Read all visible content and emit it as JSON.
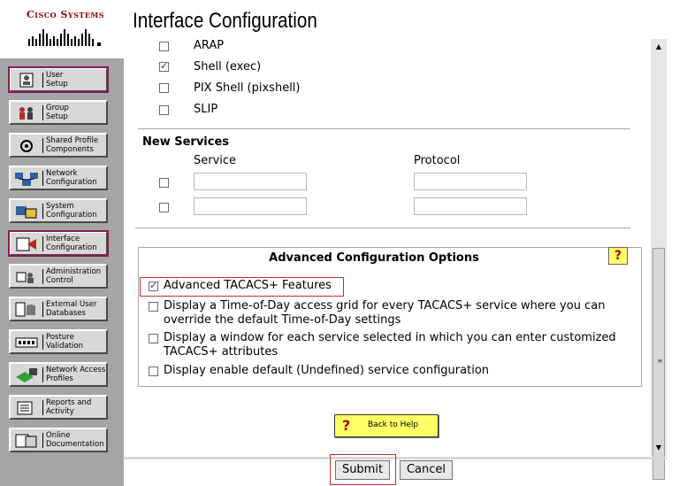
{
  "app": {
    "brand": "Cisco Systems",
    "page_title": "Interface Configuration"
  },
  "nav": [
    {
      "label": "User\nSetup",
      "icon": "user-setup-icon"
    },
    {
      "label": "Group\nSetup",
      "icon": "group-setup-icon"
    },
    {
      "label": "Shared Profile\nComponents",
      "icon": "shared-profile-icon"
    },
    {
      "label": "Network\nConfiguration",
      "icon": "network-config-icon"
    },
    {
      "label": "System\nConfiguration",
      "icon": "system-config-icon"
    },
    {
      "label": "Interface\nConfiguration",
      "icon": "interface-config-icon"
    },
    {
      "label": "Administration\nControl",
      "icon": "admin-control-icon"
    },
    {
      "label": "External User\nDatabases",
      "icon": "external-db-icon"
    },
    {
      "label": "Posture\nValidation",
      "icon": "posture-icon"
    },
    {
      "label": "Network Access\nProfiles",
      "icon": "nap-icon"
    },
    {
      "label": "Reports and\nActivity",
      "icon": "reports-icon"
    },
    {
      "label": "Online\nDocumentation",
      "icon": "docs-icon"
    }
  ],
  "services": [
    {
      "label": "ARAP",
      "checked": false
    },
    {
      "label": "Shell (exec)",
      "checked": true
    },
    {
      "label": "PIX Shell (pixshell)",
      "checked": false
    },
    {
      "label": "SLIP",
      "checked": false
    }
  ],
  "new_services": {
    "heading": "New Services",
    "service_col": "Service",
    "protocol_col": "Protocol",
    "rows": [
      {
        "checked": false,
        "service": "",
        "protocol": ""
      },
      {
        "checked": false,
        "service": "",
        "protocol": ""
      }
    ]
  },
  "advanced": {
    "title": "Advanced Configuration Options",
    "help_glyph": "?",
    "options": [
      {
        "label": "Advanced TACACS+ Features",
        "checked": true
      },
      {
        "label": "Display a Time-of-Day access grid for every TACACS+ service where you can override the default Time-of-Day settings",
        "checked": false
      },
      {
        "label": "Display a window for each service selected in which you can enter customized TACACS+ attributes",
        "checked": false
      },
      {
        "label": "Display enable default (Undefined) service configuration",
        "checked": false
      }
    ]
  },
  "back_to_help": "Back to Help",
  "buttons": {
    "submit": "Submit",
    "cancel": "Cancel"
  },
  "colors": {
    "nav_bg": "#a5a5a5",
    "highlight": "#c03030",
    "help_yellow": "#ffff66",
    "brand": "#8b0000"
  }
}
